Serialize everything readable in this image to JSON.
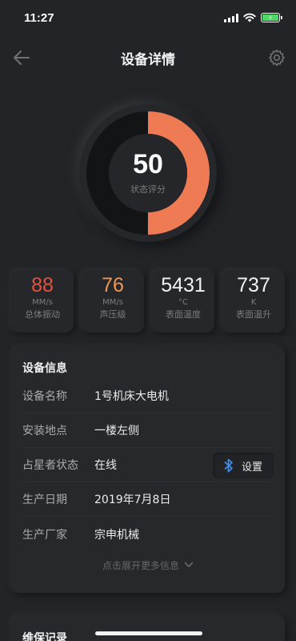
{
  "status_bar": {
    "time": "11:27"
  },
  "nav": {
    "title": "设备详情"
  },
  "gauge": {
    "value": "50",
    "label": "状态评分",
    "fill_fraction": 0.5,
    "accent": "#ef7b55",
    "track": "#121314"
  },
  "metrics": [
    {
      "value": "88",
      "unit": "MM/s",
      "label": "总体振动",
      "color": "#e8503d"
    },
    {
      "value": "76",
      "unit": "MM/s",
      "label": "声压级",
      "color": "#ef9650"
    },
    {
      "value": "5431",
      "unit": "°C",
      "label": "表面温度",
      "color": "#f1f1f1"
    },
    {
      "value": "737",
      "unit": "K",
      "label": "表面温升",
      "color": "#f1f1f1"
    }
  ],
  "info": {
    "title": "设备信息",
    "rows": [
      {
        "label": "设备名称",
        "value": "1号机床大电机"
      },
      {
        "label": "安装地点",
        "value": "一楼左侧"
      },
      {
        "label": "占星者状态",
        "value": "在线"
      },
      {
        "label": "生产日期",
        "value": "2019年7月8日"
      },
      {
        "label": "生产厂家",
        "value": "宗申机械"
      }
    ],
    "bluetooth_button": {
      "label": "设置",
      "icon": "bluetooth-icon",
      "icon_color": "#3d8cf0"
    },
    "expand_text": "点击展开更多信息"
  },
  "maintenance": {
    "title": "维保记录"
  }
}
